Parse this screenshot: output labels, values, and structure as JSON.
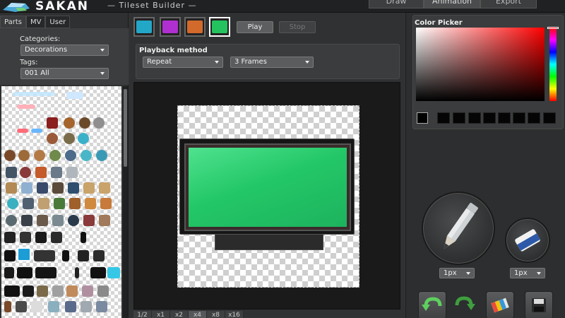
{
  "header": {
    "brand": "SAKAN",
    "subtitle": "— Tileset Builder —",
    "modes": [
      "Draw",
      "Animation",
      "Export"
    ]
  },
  "left": {
    "tabs": [
      "Parts",
      "MV",
      "User"
    ],
    "categories_label": "Categories:",
    "categories_value": "Decorations",
    "tags_label": "Tags:",
    "tags_value": "001 All"
  },
  "center": {
    "frames": [
      {
        "color": "#23a7c7"
      },
      {
        "color": "#b02fd0"
      },
      {
        "color": "#d26a2c"
      },
      {
        "color": "#25c35f"
      }
    ],
    "play_label": "Play",
    "stop_label": "Stop",
    "playback_title": "Playback method",
    "playback_value": "Repeat",
    "frames_value": "3 Frames",
    "zoom_levels": [
      "1/2",
      "x1",
      "x2",
      "x4",
      "x8",
      "x16"
    ],
    "zoom_active": "x4"
  },
  "right": {
    "picker_title": "Color Picker",
    "pencil_size": "1px",
    "eraser_size": "1px"
  }
}
